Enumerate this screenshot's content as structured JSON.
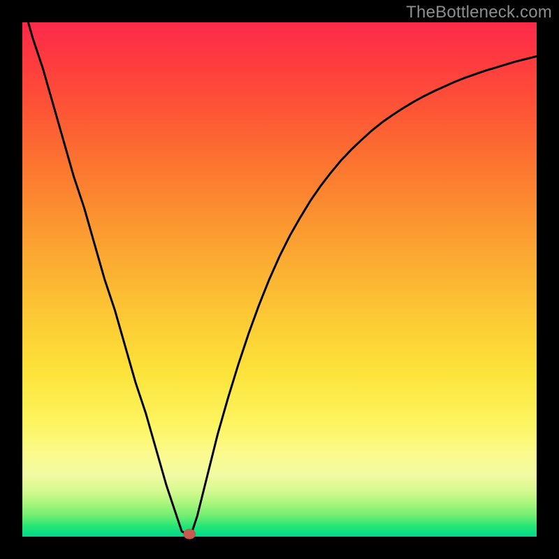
{
  "watermark": "TheBottleneck.com",
  "colors": {
    "frame": "#000000",
    "curve": "#000000",
    "marker": "#c95a4e",
    "gradient_top": "#fc2a4a",
    "gradient_bottom": "#00d98a"
  },
  "chart_data": {
    "type": "line",
    "title": "",
    "xlabel": "",
    "ylabel": "",
    "xlim": [
      0,
      100
    ],
    "ylim": [
      0,
      100
    ],
    "x": [
      0,
      2,
      4,
      6,
      8,
      10,
      12,
      14,
      16,
      18,
      20,
      22,
      24,
      26,
      28,
      30,
      31,
      32,
      33,
      34,
      36,
      38,
      40,
      42,
      44,
      46,
      48,
      50,
      52,
      54,
      56,
      58,
      60,
      62,
      64,
      66,
      68,
      70,
      72,
      74,
      76,
      78,
      80,
      82,
      84,
      86,
      88,
      90,
      92,
      94,
      96,
      98,
      100
    ],
    "y": [
      104,
      97,
      91,
      84,
      77,
      70,
      64,
      57,
      50,
      44,
      37,
      30,
      24,
      17,
      10,
      4,
      1,
      0.5,
      1,
      4,
      12,
      20,
      27,
      33.5,
      39.5,
      45,
      50,
      54.5,
      58.5,
      62,
      65.3,
      68.2,
      70.8,
      73.2,
      75.3,
      77.2,
      79,
      80.6,
      82,
      83.3,
      84.5,
      85.6,
      86.6,
      87.5,
      88.4,
      89.2,
      89.9,
      90.6,
      91.2,
      91.8,
      92.4,
      92.9,
      93.4
    ],
    "marker": {
      "x": 32.5,
      "y": 0.5,
      "rx": 1.2,
      "ry": 1.0
    }
  }
}
